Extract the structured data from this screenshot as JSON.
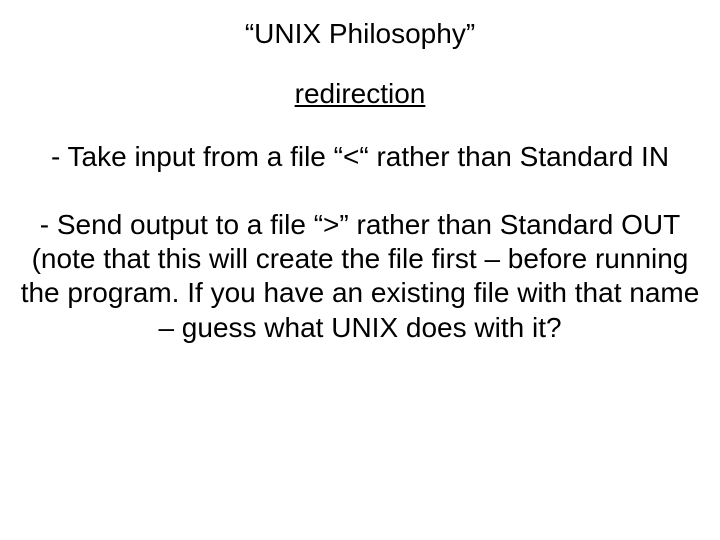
{
  "title": "“UNIX Philosophy”",
  "subtitle": "redirection",
  "bullet1": "- Take input from a file “<“ rather than Standard IN",
  "bullet2": "-  Send output to a file “>” rather than Standard OUT\n(note that this will create the file first – before running the program. If you have an existing file with that name – guess what UNIX does with it?"
}
